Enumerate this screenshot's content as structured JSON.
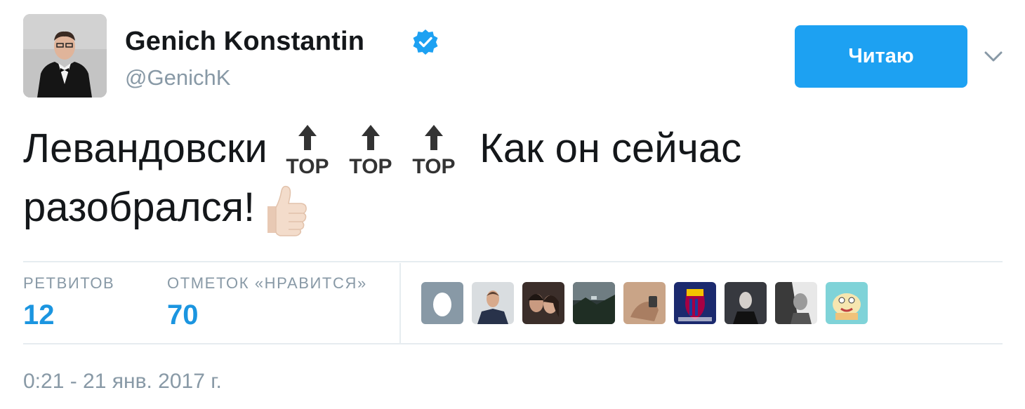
{
  "user": {
    "display_name": "Genich Konstantin",
    "handle": "@GenichK",
    "verified": true,
    "avatar_icon": "profile-photo-man-in-tuxedo"
  },
  "follow_button": {
    "label": "Читаю"
  },
  "menu_icon": "chevron-down-icon",
  "tweet": {
    "text_part1": "Левандовски",
    "emoji_top": "TOP",
    "text_part2": "Как он сейчас",
    "text_part3": "разобрался!",
    "emoji_thumb_icon": "thumbs-up-emoji"
  },
  "stats": {
    "retweets_label": "РЕТВИТОВ",
    "retweets_count": "12",
    "likes_label": "ОТМЕТОК «НРАВИТСЯ»",
    "likes_count": "70"
  },
  "likers": [
    {
      "name": "liker-avatar-egg"
    },
    {
      "name": "liker-avatar-man-suit"
    },
    {
      "name": "liker-avatar-couple"
    },
    {
      "name": "liker-avatar-landscape"
    },
    {
      "name": "liker-avatar-hand"
    },
    {
      "name": "liker-avatar-fcb-logo"
    },
    {
      "name": "liker-avatar-man-dark"
    },
    {
      "name": "liker-avatar-bw-photo"
    },
    {
      "name": "liker-avatar-cartoon"
    }
  ],
  "timestamp": "0:21 - 21 янв. 2017 г.",
  "colors": {
    "accent": "#1da1f2",
    "link": "#1b95e0",
    "muted": "#8899a6",
    "text": "#14171a"
  }
}
